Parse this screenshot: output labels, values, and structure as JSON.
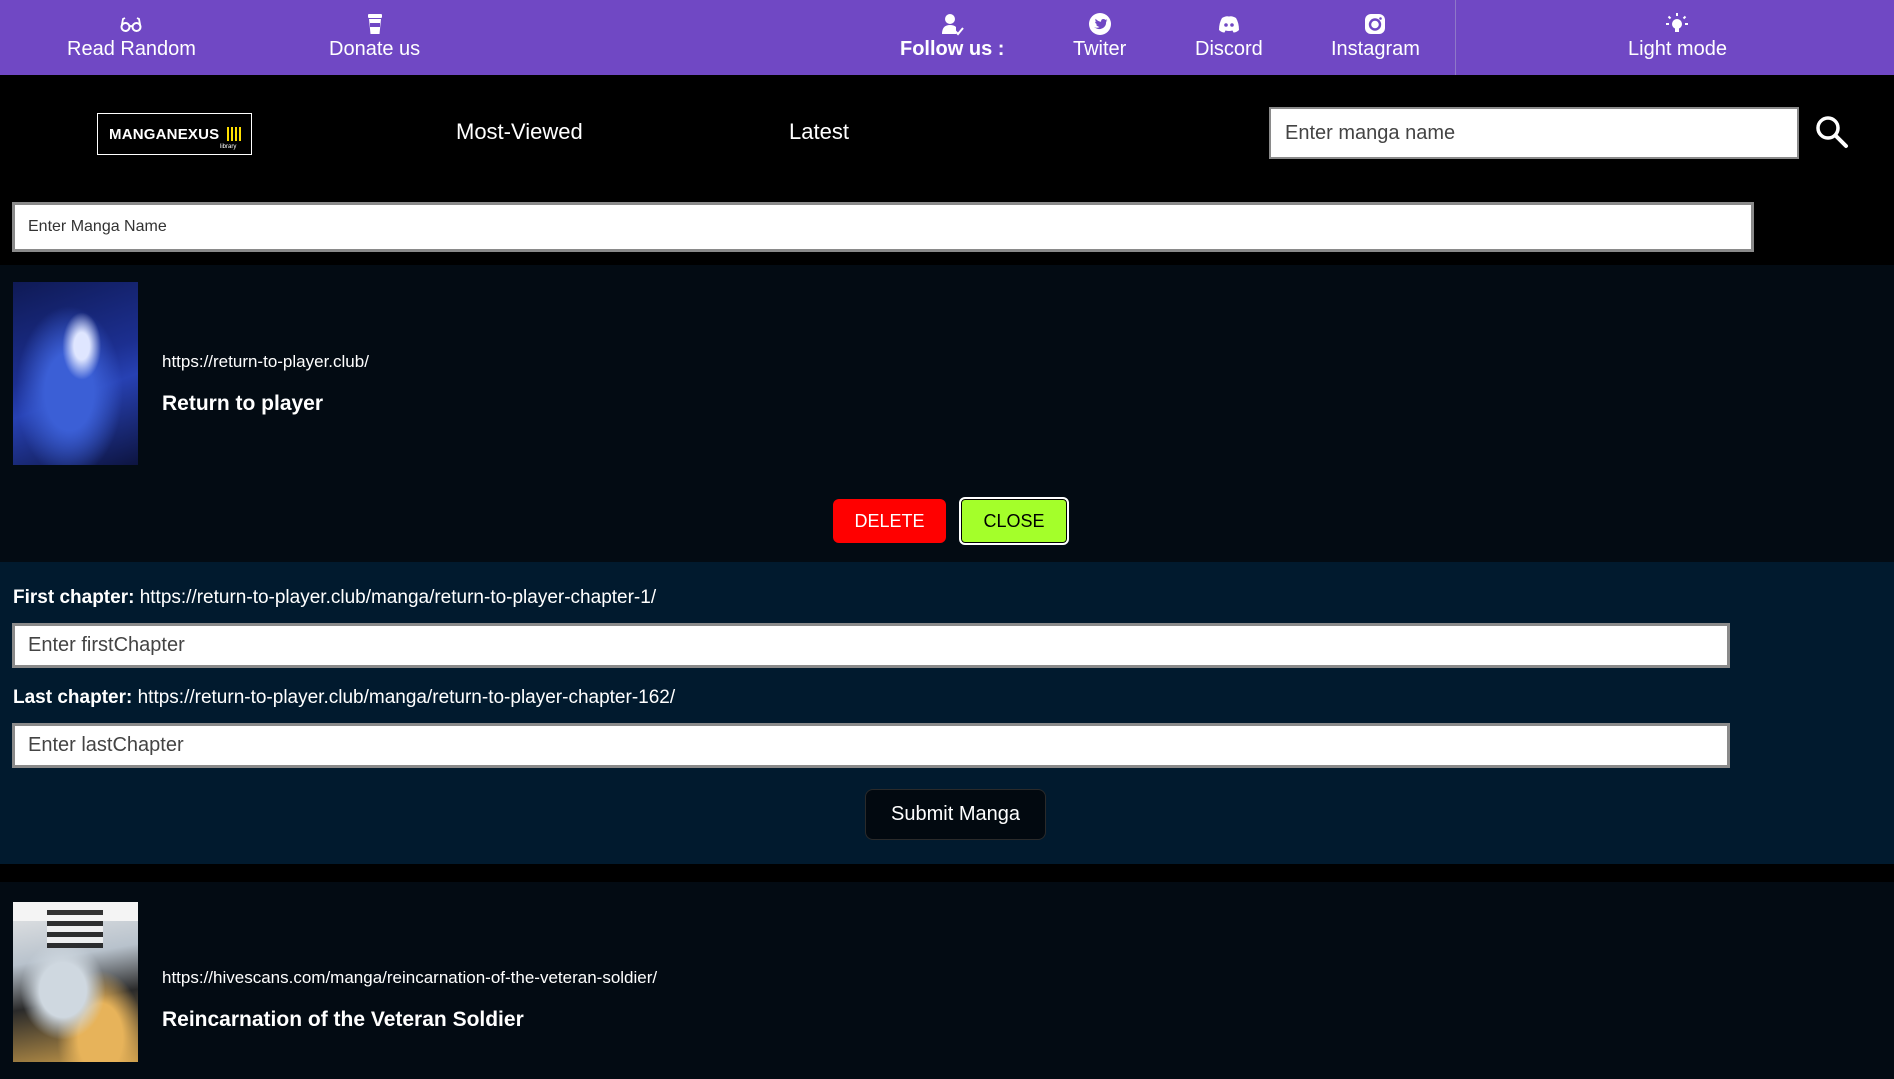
{
  "topbar": {
    "read_random": "Read Random",
    "donate": "Donate us",
    "follow_us": "Follow us :",
    "twitter": "Twiter",
    "discord": "Discord",
    "instagram": "Instagram",
    "light_mode": "Light mode",
    "color": "#7048c4"
  },
  "nav": {
    "logo_text": "MANGANEXUS",
    "logo_sub": "library",
    "most_viewed": "Most-Viewed",
    "latest": "Latest",
    "search_placeholder": "Enter manga name"
  },
  "filter": {
    "placeholder": "Enter Manga Name"
  },
  "mangas": [
    {
      "url": "https://return-to-player.club/",
      "title": "Return to player",
      "delete_label": "DELETE",
      "close_label": "CLOSE"
    },
    {
      "url": "https://hivescans.com/manga/reincarnation-of-the-veteran-soldier/",
      "title": "Reincarnation of the Veteran Soldier"
    }
  ],
  "edit": {
    "first_label": "First chapter:",
    "first_value": "https://return-to-player.club/manga/return-to-player-chapter-1/",
    "first_placeholder": "Enter firstChapter",
    "last_label": "Last chapter:",
    "last_value": "https://return-to-player.club/manga/return-to-player-chapter-162/",
    "last_placeholder": "Enter lastChapter",
    "submit_label": "Submit Manga"
  },
  "colors": {
    "delete": "#ff0000",
    "close": "#a4ff2a",
    "edit_panel": "#011a2e"
  }
}
